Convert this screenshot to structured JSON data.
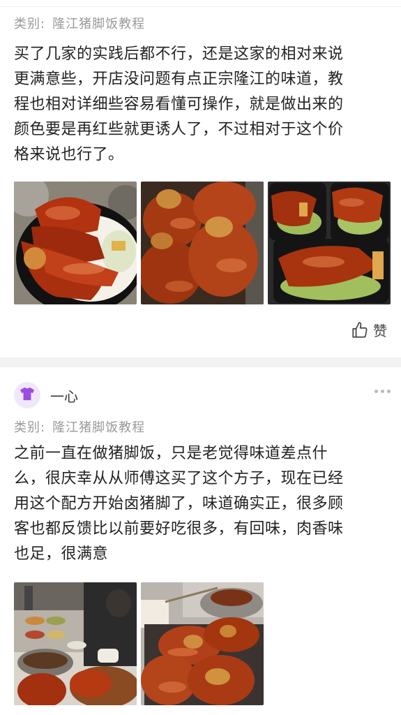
{
  "post1": {
    "category_label": "类别:",
    "category_value": "隆江猪脚饭教程",
    "text_lines": [
      "买了几家的实践后都不行，还是这家的相对来说",
      "更满意些，开店没问题有点正宗隆江的味道，教",
      "程也相对详细些容易看懂可操作，就是做出来的",
      "颜色要是再红些就更诱人了，不过相对于这个价",
      "格来说也行了。"
    ],
    "like_label": "赞",
    "photos": [
      "pork-knuckle-rice-photo",
      "braised-trotters-tray-photo",
      "takeout-boxes-photo"
    ]
  },
  "post2": {
    "username": "一心",
    "category_label": "类别:",
    "category_value": "隆江猪脚饭教程",
    "text_lines": [
      "之前一直在做猪脚饭，只是老觉得味道差点什",
      "么，很庆幸从从师傅这买了这个方子，现在已经",
      "用这个配方开始卤猪脚了，味道确实正，很多顾",
      "客也都反馈比以前要好吃很多，有回味，肉香味",
      "也足，很满意"
    ],
    "photos": [
      "food-stall-photo",
      "braised-trotters-pan-photo"
    ]
  },
  "colors": {
    "avatar_bg": "#f1e7fb",
    "avatar_icon": "#9b4de0",
    "muted_text": "#9a9a9a",
    "divider": "#f2f2f2"
  }
}
